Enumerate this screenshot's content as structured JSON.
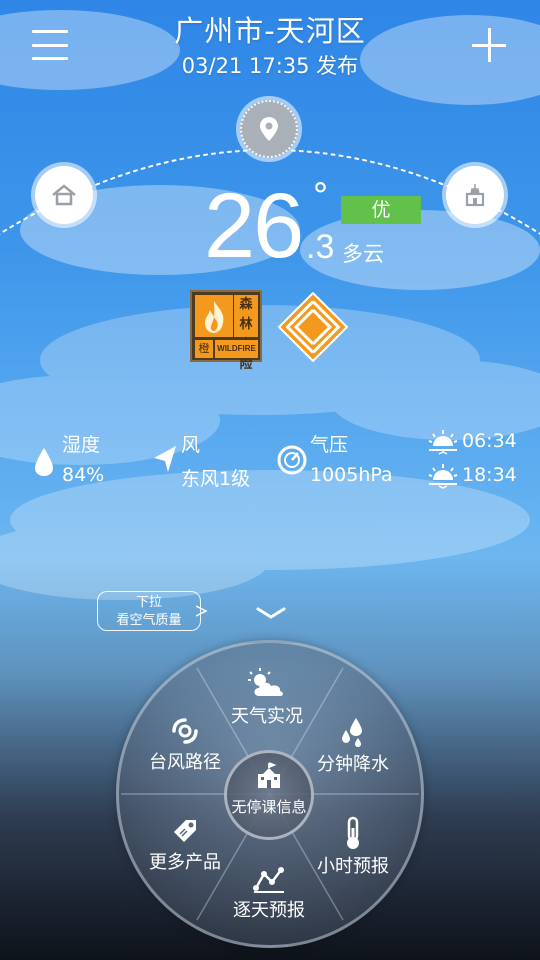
{
  "header": {
    "city": "广州市-天河区",
    "publish_time": "03/21  17:35 发布",
    "menu_icon": "menu-icon",
    "add_icon": "plus-icon"
  },
  "locations": [
    {
      "icon": "home-icon"
    },
    {
      "icon": "location-pin-icon"
    },
    {
      "icon": "landmark-icon"
    }
  ],
  "current": {
    "temp_int": "26",
    "temp_decimal": ".3",
    "degree": "°",
    "condition": "多云",
    "aqi": "优",
    "aqi_color": "#62c14a"
  },
  "alerts": {
    "forest_fire": {
      "line1": "森林",
      "line2": "火险",
      "level": "橙",
      "english": "WILDFIRE",
      "color": "#f39a1e"
    },
    "second_icon": "orange-alert-icon"
  },
  "stats": {
    "humidity": {
      "label": "湿度",
      "value": "84%"
    },
    "wind": {
      "label": "风",
      "value": "东风1级"
    },
    "pressure": {
      "label": "气压",
      "value": "1005hPa"
    },
    "sunrise": "06:34",
    "sunset": "18:34"
  },
  "pull_hint": {
    "line1": "下拉",
    "line2": "看空气质量"
  },
  "wheel": {
    "center": "无停课信息",
    "items": {
      "live": "天气实况",
      "typhoon": "台风路径",
      "rain": "分钟降水",
      "more": "更多产品",
      "hourly": "小时预报",
      "daily": "逐天预报"
    }
  }
}
